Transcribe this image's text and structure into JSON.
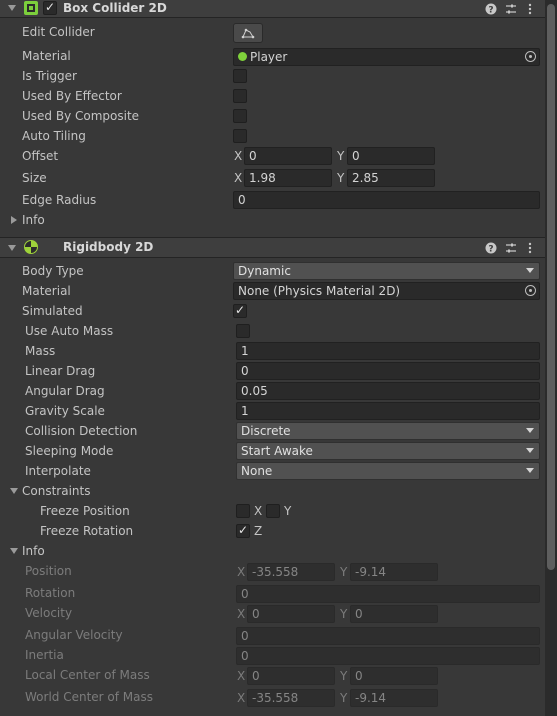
{
  "box_collider": {
    "title": "Box Collider 2D",
    "edit_collider_label": "Edit Collider",
    "edit_collider_icon": "polygon-edit-icon",
    "material_label": "Material",
    "material_value": "Player",
    "is_trigger_label": "Is Trigger",
    "used_by_effector_label": "Used By Effector",
    "used_by_composite_label": "Used By Composite",
    "auto_tiling_label": "Auto Tiling",
    "offset_label": "Offset",
    "offset_x": "0",
    "offset_y": "0",
    "size_label": "Size",
    "size_x": "1.98",
    "size_y": "2.85",
    "edge_radius_label": "Edge Radius",
    "edge_radius_value": "0",
    "info_label": "Info",
    "is_trigger": false,
    "used_by_effector": false,
    "used_by_composite": false,
    "auto_tiling": false
  },
  "rigidbody": {
    "title": "Rigidbody 2D",
    "body_type_label": "Body Type",
    "body_type_value": "Dynamic",
    "material_label": "Material",
    "material_value": "None (Physics Material 2D)",
    "simulated_label": "Simulated",
    "simulated": true,
    "use_auto_mass_label": "Use Auto Mass",
    "use_auto_mass": false,
    "mass_label": "Mass",
    "mass_value": "1",
    "linear_drag_label": "Linear Drag",
    "linear_drag_value": "0",
    "angular_drag_label": "Angular Drag",
    "angular_drag_value": "0.05",
    "gravity_scale_label": "Gravity Scale",
    "gravity_scale_value": "1",
    "collision_detection_label": "Collision Detection",
    "collision_detection_value": "Discrete",
    "sleeping_mode_label": "Sleeping Mode",
    "sleeping_mode_value": "Start Awake",
    "interpolate_label": "Interpolate",
    "interpolate_value": "None",
    "constraints_label": "Constraints",
    "freeze_position_label": "Freeze Position",
    "freeze_position_x": false,
    "freeze_position_y": false,
    "freeze_rotation_label": "Freeze Rotation",
    "freeze_rotation_z": true,
    "info_label": "Info",
    "info": {
      "position_label": "Position",
      "position_x": "-35.558",
      "position_y": "-9.14",
      "rotation_label": "Rotation",
      "rotation_value": "0",
      "velocity_label": "Velocity",
      "velocity_x": "0",
      "velocity_y": "0",
      "angular_velocity_label": "Angular Velocity",
      "angular_velocity_value": "0",
      "inertia_label": "Inertia",
      "inertia_value": "0",
      "local_com_label": "Local Center of Mass",
      "local_com_x": "0",
      "local_com_y": "0",
      "world_com_label": "World Center of Mass",
      "world_com_x": "-35.558",
      "world_com_y": "-9.14"
    }
  },
  "axes": {
    "x": "X",
    "y": "Y",
    "z": "Z"
  },
  "header_icons": [
    "help-icon",
    "presets-icon",
    "more-icon"
  ],
  "colors": {
    "background": "#383838",
    "header": "#3e3e3e",
    "field": "#2a2a2a",
    "dropdown": "#515151",
    "collider_icon": "#7ccf3c",
    "rigidbody_icon": "#9ed23a"
  }
}
